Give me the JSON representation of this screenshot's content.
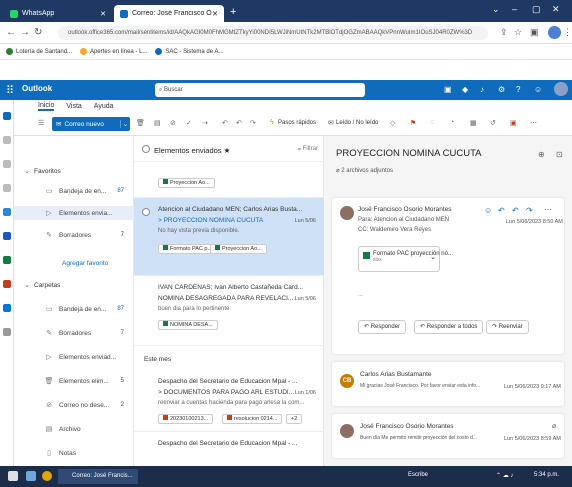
{
  "browser": {
    "tabs": [
      {
        "label": "WhatsApp"
      },
      {
        "label": "Correo: José Francisco Osorio M"
      }
    ],
    "new_tab": "+",
    "url": "outlook.office365.com/mail/sentitems/id/AAQkAGI0M0FhMGMtZTkyYi00NDI5LWJiNmUtNTk2MTBlOTdjOGZmABAAQkVPnnWuIm1IOuSJ04R0ZW%3D",
    "bookmarks": [
      "Lotería de Santand...",
      "Apertes en línea - L...",
      "SAC - Sistema de A..."
    ]
  },
  "outlook": {
    "app_title": "Outlook",
    "search_placeholder": "Buscar",
    "ribbon_tabs": [
      "Inicio",
      "Vista",
      "Ayuda"
    ],
    "new_mail": "Correo nuevo",
    "quick_steps": "Pasos rápidos",
    "read_unread": "Leído / No leído"
  },
  "folders": {
    "favorites_label": "Favoritos",
    "favorites": [
      {
        "name": "Bandeja de en...",
        "count": "87"
      },
      {
        "name": "Elementos envia...",
        "count": ""
      },
      {
        "name": "Borradores",
        "count": "7"
      }
    ],
    "add_favorite": "Agregar favorito",
    "folders_label": "Carpetas",
    "folders": [
      {
        "name": "Bandeja de en...",
        "count": "87"
      },
      {
        "name": "Borradores",
        "count": "7"
      },
      {
        "name": "Elementos enviad...",
        "count": ""
      },
      {
        "name": "Elementos elim...",
        "count": "5"
      },
      {
        "name": "Correo no dese...",
        "count": "2"
      },
      {
        "name": "Archivo",
        "count": ""
      },
      {
        "name": "Notas",
        "count": ""
      }
    ]
  },
  "message_list": {
    "title": "Elementos enviados",
    "filter": "Filtrar",
    "top_chip": "Proyeccion Ao...",
    "messages": [
      {
        "from": "Atencion al Ciudadano MEN; Carlos Arias Busta...",
        "subject": "> PROYECCION NOMINA CUCUTA",
        "preview": "No hay vista previa disponible.",
        "date": "Lun 5/06",
        "chips": [
          "Formato PAC p...",
          "Proyeccion Ao..."
        ]
      },
      {
        "from": "IVAN CARDENAS; Ivan Alberto Castañeda Card...",
        "subject": "NOMINA DESAGREGADA PARA REVELACI...",
        "preview": "buen dia para lo pertinente",
        "date": "Lun 5/06",
        "chips": [
          "NOMINA DESA..."
        ]
      }
    ],
    "group_label": "Este mes",
    "messages2": [
      {
        "from": "Despacho del Secretario de Educacion Mpal - ...",
        "subject": "> DOCUMENTOS PARA PAGO ARL ESTUDI...",
        "preview": "reenviar a cuentas hacienda para pago arlesa la com...",
        "date": "Lun 1/06",
        "chips": [
          "20230100213...",
          "resolucion 0214...",
          "+2"
        ]
      },
      {
        "from": "Despacho del Secretario de Educacion Mpal - ...",
        "subject": "",
        "preview": "",
        "date": "",
        "chips": []
      }
    ]
  },
  "reading": {
    "subject": "PROYECCION NOMINA CUCUTA",
    "attachments": "2 archivos adjuntos",
    "card1": {
      "from": "José Francisco Osorio Morantes",
      "to": "Para: Atencion al Ciudadano MEN",
      "cc": "CC: Waldemiro Vera Reyes",
      "date": "Lun 5/06/2023 8:50 AM",
      "attachment": "Formato PAC proyección nó...",
      "attachment_sub": "xlsx",
      "reply": "Responder",
      "reply_all": "Responder a todos",
      "forward": "Reenviar",
      "dots": "..."
    },
    "card2": {
      "initials": "CB",
      "from": "Carlos Arias Bustamante",
      "preview": "Mi gracias José Francisco. Por favor enviar esta info...",
      "date": "Lun 5/06/2023 9:17 AM"
    },
    "card3": {
      "from": "José Francisco Osorio Morantes",
      "preview": "Buen día Me permito remitir proyección del costo d...",
      "date": "Lun 5/06/2023 8:59 AM"
    }
  },
  "taskbar": {
    "active_task": "Correo: José Francis...",
    "search_hint": "Escribe",
    "clock": "5:34 p.m."
  }
}
